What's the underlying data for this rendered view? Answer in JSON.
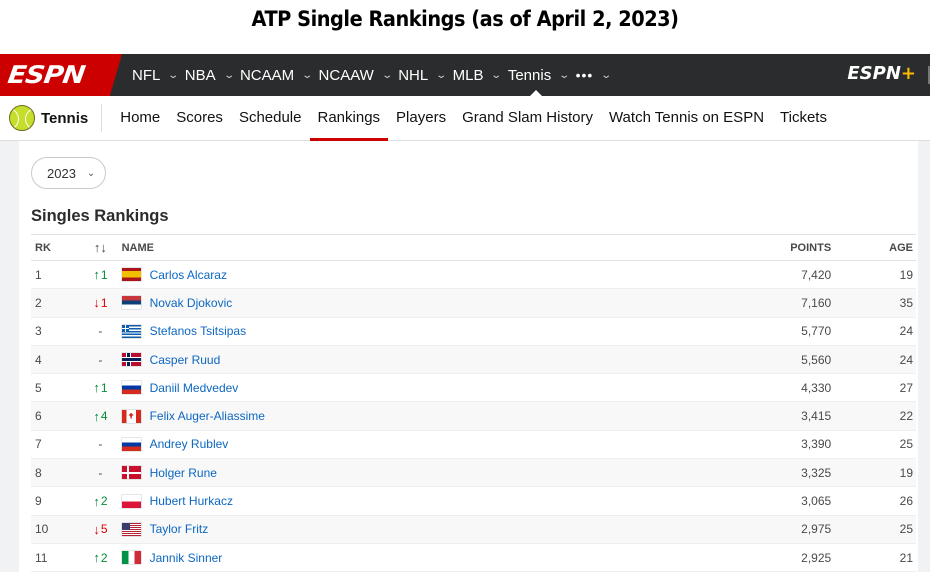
{
  "caption": "ATP Single Rankings (as of April 2, 2023)",
  "topbar": {
    "logo": "ESPN",
    "sports": [
      {
        "label": "NFL",
        "active": false
      },
      {
        "label": "NBA",
        "active": false
      },
      {
        "label": "NCAAM",
        "active": false
      },
      {
        "label": "NCAAW",
        "active": false
      },
      {
        "label": "NHL",
        "active": false
      },
      {
        "label": "MLB",
        "active": false
      },
      {
        "label": "Tennis",
        "active": true
      }
    ],
    "more_label": "•••",
    "espn_plus_label": "ESPN",
    "espn_plus_suffix": "+"
  },
  "subnav": {
    "title": "Tennis",
    "links": [
      "Home",
      "Scores",
      "Schedule",
      "Rankings",
      "Players",
      "Grand Slam History",
      "Watch Tennis on ESPN",
      "Tickets"
    ],
    "active_index": 3
  },
  "year_select": {
    "value": "2023"
  },
  "section_title": "Singles Rankings",
  "table": {
    "headers": {
      "rank": "RK",
      "trend": "↑↓",
      "name": "NAME",
      "points": "POINTS",
      "age": "AGE"
    },
    "rows": [
      {
        "rank": "1",
        "trend_dir": "up",
        "trend": "1",
        "flag": "ESP",
        "name": "Carlos Alcaraz",
        "points": "7,420",
        "age": "19"
      },
      {
        "rank": "2",
        "trend_dir": "down",
        "trend": "1",
        "flag": "SRB",
        "name": "Novak Djokovic",
        "points": "7,160",
        "age": "35"
      },
      {
        "rank": "3",
        "trend_dir": "none",
        "trend": "-",
        "flag": "GRE",
        "name": "Stefanos Tsitsipas",
        "points": "5,770",
        "age": "24"
      },
      {
        "rank": "4",
        "trend_dir": "none",
        "trend": "-",
        "flag": "NOR",
        "name": "Casper Ruud",
        "points": "5,560",
        "age": "24"
      },
      {
        "rank": "5",
        "trend_dir": "up",
        "trend": "1",
        "flag": "RUS",
        "name": "Daniil Medvedev",
        "points": "4,330",
        "age": "27"
      },
      {
        "rank": "6",
        "trend_dir": "up",
        "trend": "4",
        "flag": "CAN",
        "name": "Felix Auger-Aliassime",
        "points": "3,415",
        "age": "22"
      },
      {
        "rank": "7",
        "trend_dir": "none",
        "trend": "-",
        "flag": "RUS",
        "name": "Andrey Rublev",
        "points": "3,390",
        "age": "25"
      },
      {
        "rank": "8",
        "trend_dir": "none",
        "trend": "-",
        "flag": "DEN",
        "name": "Holger Rune",
        "points": "3,325",
        "age": "19"
      },
      {
        "rank": "9",
        "trend_dir": "up",
        "trend": "2",
        "flag": "POL",
        "name": "Hubert Hurkacz",
        "points": "3,065",
        "age": "26"
      },
      {
        "rank": "10",
        "trend_dir": "down",
        "trend": "5",
        "flag": "USA",
        "name": "Taylor Fritz",
        "points": "2,975",
        "age": "25"
      },
      {
        "rank": "11",
        "trend_dir": "up",
        "trend": "2",
        "flag": "ITA",
        "name": "Jannik Sinner",
        "points": "2,925",
        "age": "21"
      }
    ]
  },
  "colors": {
    "espn_red": "#cc0000",
    "nav_dark": "#2b2c2d",
    "link_blue": "#0c67c1",
    "up_green": "#008e36",
    "down_red": "#dd0000"
  }
}
